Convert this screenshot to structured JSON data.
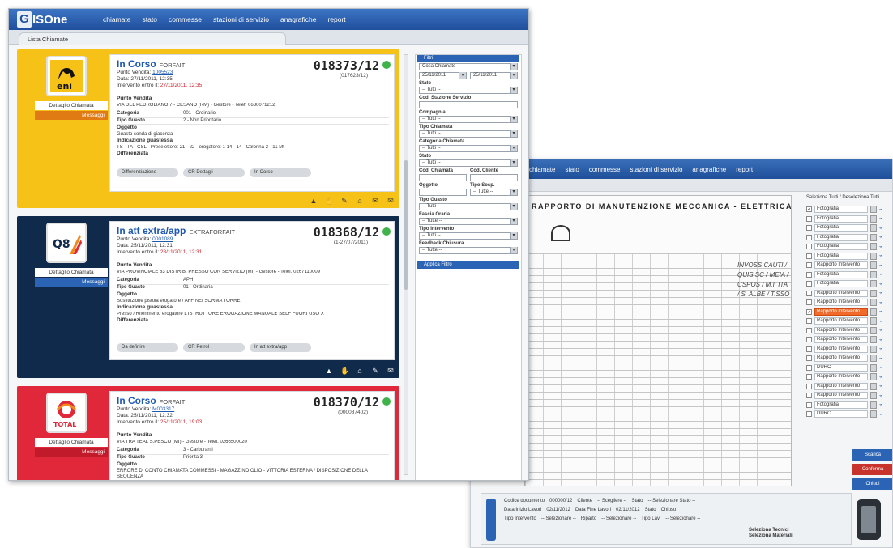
{
  "back_window": {
    "nav": [
      "chiamate",
      "stato",
      "commesse",
      "stazioni di servizio",
      "anagrafiche",
      "report"
    ],
    "tab_label": "Lista Chiamate",
    "doc_title": "RAPPORTO DI MANUTENZIONE MECCANICA - ELETTRICA - ELE",
    "doc_handwriting": "INVOSS CAUTI / QUIS SC / MEIA / CSPOS / M.I. ITA / S. ALBE / T.SSO",
    "checklist_header": "Seleziona Tutti / Deseleziona Tutti",
    "checklist": [
      {
        "label": "Fotografia",
        "checked": true
      },
      {
        "label": "Fotografia",
        "checked": false
      },
      {
        "label": "Fotografia",
        "checked": false
      },
      {
        "label": "Fotografia",
        "checked": false
      },
      {
        "label": "Fotografia",
        "checked": false
      },
      {
        "label": "Fotografia",
        "checked": false
      },
      {
        "label": "Rapporto Intervento",
        "checked": false
      },
      {
        "label": "Fotografia",
        "checked": false
      },
      {
        "label": "Fotografia",
        "checked": false
      },
      {
        "label": "Rapporto Intervento",
        "checked": false
      },
      {
        "label": "Rapporto Intervento",
        "checked": false
      },
      {
        "label": "Rapporto Intervento",
        "checked": true,
        "highlight": true
      },
      {
        "label": "Rapporto Intervento",
        "checked": false
      },
      {
        "label": "Rapporto Intervento",
        "checked": false
      },
      {
        "label": "Rapporto Intervento",
        "checked": false
      },
      {
        "label": "Rapporto Intervento",
        "checked": false
      },
      {
        "label": "Rapporto Intervento",
        "checked": false
      },
      {
        "label": "DURC",
        "checked": false
      },
      {
        "label": "Rapporto Intervento",
        "checked": false
      },
      {
        "label": "Rapporto Intervento",
        "checked": false
      },
      {
        "label": "Rapporto Intervento",
        "checked": false
      },
      {
        "label": "Fotografia",
        "checked": false
      },
      {
        "label": "DURC",
        "checked": false
      }
    ],
    "buttons": [
      {
        "label": "Scarica",
        "color": "#2c64b5"
      },
      {
        "label": "Conferma",
        "color": "#c8332b"
      },
      {
        "label": "Chiudi",
        "color": "#2c64b5"
      }
    ],
    "form": {
      "codice_documento_label": "Codice documento",
      "codice_documento_value": "000000/12",
      "data_inizio_label": "Data Inizio Lavori",
      "data_inizio_value": "02/11/2012",
      "data_fine_label": "Data Fine Lavori",
      "data_fine_value": "02/11/2012",
      "cliente_label": "Cliente",
      "cliente_value": "-- Scegliere --",
      "tipo_intervento_label": "Tipo Intervento",
      "tipo_intervento_value": "-- Selezionare --",
      "stato_label": "Stato",
      "stato_value": "-- Selezionare Stato --",
      "stato2_label": "Stato",
      "stato2_value": "Chiuso",
      "riparto_label": "Riparto",
      "riparto_value": "-- Selezionare --",
      "tipo_lav_label": "Tipo Lav.",
      "tipo_lav_value": "-- Selezionare --",
      "seleziona_tecnici": "Seleziona Tecnici",
      "seleziona_materiali": "Seleziona Materiali"
    }
  },
  "app": {
    "logo_g": "G",
    "logo_rest": "ISOne",
    "nav": [
      "chiamate",
      "stato",
      "commesse",
      "stazioni di servizio",
      "anagrafiche",
      "report"
    ],
    "tab_label": "Lista Chiamate"
  },
  "cards": [
    {
      "brand": "eni",
      "brand_color": "#f7c218",
      "msg_color": "#e07a12",
      "status": "In Corso",
      "status_tag": "FORFAIT",
      "number": "018373/12",
      "sub": "(017623/12)",
      "punto_vendita_label": "Punto Vendita:",
      "punto_vendita_value": "1005523",
      "data_label": "Data:",
      "data_value": "27/11/2011, 12:35",
      "intervento_label": "Intervento entro il:",
      "intervento_value": "27/11/2011, 12:35",
      "punto_vendita_title": "Punto Vendita",
      "punto_vendita_addr": "VIA DEL PEDROLIANO 7 - CESANO (RM) - Gestore - Telef. 0630071212",
      "categoria_label": "Categoria",
      "categoria_value": "001 - Ordinario",
      "tipo_guasto_label": "Tipo Guasto",
      "tipo_guasto_value": "2 - Non Prioritario",
      "oggetto_label": "Oggetto",
      "oggetto_value": "Guasto sonda di giacenza",
      "indicazione_label": "Indicazione guastessa",
      "indicazione_value": "TS - TA - CSL - Preselettore: 21 - 22 - erogatore: 1 14 - 14 - Colonna 2 - 11 Mt",
      "differenziata_label": "Differenziata",
      "pills": [
        "Differenziazione",
        "CR Dettagli",
        "In Corso"
      ],
      "icons": [
        "▲",
        "✋",
        "✎",
        "⌂",
        "✉",
        "✉"
      ],
      "detail_label": "Dettaglio Chiamata",
      "msg_label": "Messaggi"
    },
    {
      "brand": "Q8",
      "brand_color": "#0f2a4a",
      "msg_color": "#2c64b5",
      "status": "In att extra/app",
      "status_tag": "EXTRAFORFAIT",
      "number": "018368/12",
      "sub": "(1-27/07/2011)",
      "punto_vendita_label": "Punto Vendita:",
      "punto_vendita_value": "0001089",
      "data_label": "Data:",
      "data_value": "25/11/2011, 12:31",
      "intervento_label": "Intervento entro il:",
      "intervento_value": "28/11/2011, 12:31",
      "punto_vendita_title": "Punto Vendita",
      "punto_vendita_addr": "VIA PROVINCIALE 83 DISTRIB. PRESSO CON SERVIZIO (MI) - Gestore - Telef. 0267110009",
      "categoria_label": "Categoria",
      "categoria_value": "APH",
      "tipo_guasto_label": "Tipo Guasto",
      "tipo_guasto_value": "01 - Ordinaria",
      "oggetto_label": "Oggetto",
      "oggetto_value": "Sostituzione pistola erogatore / AFF NEI SORMA TORRE",
      "indicazione_label": "Indicazione guastessa",
      "indicazione_value": "Presso / Riferimento erogatore L'ISTRUTTORE EROGAZIONE MANUALE SELF FUORI USO X",
      "differenziata_label": "Differenziata",
      "pills": [
        "Da definire",
        "CR Petrol",
        "In att extra/app"
      ],
      "icons": [
        "▲",
        "✋",
        "⌂",
        "✎",
        "✉"
      ],
      "detail_label": "Dettaglio Chiamata",
      "msg_label": "Messaggi"
    },
    {
      "brand": "TOTAL",
      "brand_color": "#e0283a",
      "msg_color": "#c01a2b",
      "status": "In Corso",
      "status_tag": "FORFAIT",
      "number": "018370/12",
      "sub": "(000087402)",
      "punto_vendita_label": "Punto Vendita:",
      "punto_vendita_value": "M003317",
      "data_label": "Data:",
      "data_value": "25/11/2011, 12:32",
      "intervento_label": "Intervento entro il:",
      "intervento_value": "25/11/2011, 19:03",
      "punto_vendita_title": "Punto Vendita",
      "punto_vendita_addr": "VIA TRA TEAL S.PESCO (MI) - Gestore - Telef. 0266500020",
      "categoria_label": "Categoria",
      "categoria_value": "3 - Carburanti",
      "tipo_guasto_label": "Tipo Guasto",
      "tipo_guasto_value": "Priorita 3",
      "oggetto_label": "Oggetto",
      "oggetto_value": "ERRORE DI CONTO CHIAMATA COMMESSI - MAGAZZINO OLIO - VITTORIA ESTERNA / DISPOSIZIONE DELLA SEQUENZA",
      "detail_label": "Dettaglio Chiamata",
      "msg_label": "Messaggi"
    }
  ],
  "filter": {
    "title": "Filtri",
    "cosa_value": "Cosa Chiamate",
    "date_from": "25/11/2011",
    "date_to": "25/11/2011",
    "fields": [
      {
        "label": "Stato",
        "value": "-- Tutti --"
      },
      {
        "label": "Cod. Stazione Servizio",
        "value": ""
      },
      {
        "label": "Compagnia",
        "value": "-- Tutti --"
      },
      {
        "label": "Tipo Chiamata",
        "value": "-- Tutti --"
      },
      {
        "label": "Categoria Chiamata",
        "value": "-- Tutti --"
      },
      {
        "label": "Stato",
        "value": "-- Tutti --"
      }
    ],
    "cod_chiamata_label": "Cod. Chiamata",
    "cod_cliente_label": "Cod. Cliente",
    "oggetto_label": "Oggetto",
    "tipo_sosp_label": "Tipo Sosp.",
    "tipo_sosp_value": "-- Tutte --",
    "fields2": [
      {
        "label": "Tipo Guasto",
        "value": "-- Tutti --"
      },
      {
        "label": "Fascia Oraria",
        "value": "-- Tutte --"
      },
      {
        "label": "Tipo Intervento",
        "value": "-- Tutti --"
      },
      {
        "label": "Feedback Chiusura",
        "value": "-- Tutte --"
      }
    ],
    "apply_label": "Applica Filtro"
  }
}
